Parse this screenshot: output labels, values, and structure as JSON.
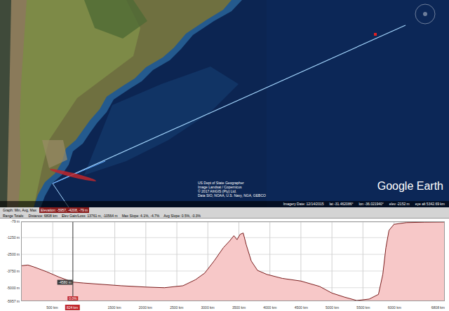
{
  "map": {
    "attribution": [
      "US Dept of State Geographer",
      "Image Landsat / Copernicus",
      "© 2017 AfriGIS (Pty) Ltd.",
      "Data SIO, NOAA, U.S. Navy, NGA, GEBCO"
    ],
    "logo": "Google Earth",
    "status": [
      "Imagery Date: 12/14/2015",
      "lat -31.462086°",
      "lon -36.021940°",
      "elev -2152 m",
      "eye alt 5342.69 km"
    ]
  },
  "graph": {
    "summary_label": "Graph: Min, Avg, Max",
    "summary_value": "Elevation: -5957, -4208, -79 m",
    "totals": [
      "Range Totals:",
      "Distance: 6808 km",
      "Elev Gain/Loss: 13761 m, -10564 m",
      "Max Slope: 4.1%, -4.7%",
      "Avg Slope: 0.5%, -0.3%"
    ],
    "y_ticks": [
      {
        "label": "-79 m",
        "value": -79
      },
      {
        "label": "-1250 m",
        "value": -1250
      },
      {
        "label": "-2500 m",
        "value": -2500
      },
      {
        "label": "-3750 m",
        "value": -3750
      },
      {
        "label": "-5000 m",
        "value": -5000
      },
      {
        "label": "-5957 m",
        "value": -5957
      }
    ],
    "x_ticks": [
      {
        "label": "500 km",
        "value": 500
      },
      {
        "label": "1500 km",
        "value": 1500
      },
      {
        "label": "2000 km",
        "value": 2000
      },
      {
        "label": "2500 km",
        "value": 2500
      },
      {
        "label": "3000 km",
        "value": 3000
      },
      {
        "label": "3500 km",
        "value": 3500
      },
      {
        "label": "4000 km",
        "value": 4000
      },
      {
        "label": "4500 km",
        "value": 4500
      },
      {
        "label": "5000 km",
        "value": 5000
      },
      {
        "label": "5500 km",
        "value": 5500
      },
      {
        "label": "6000 km",
        "value": 6000
      },
      {
        "label": "6808 km",
        "value": 6808
      }
    ],
    "cursor": {
      "distance_km": 824,
      "distance_label": "824 km",
      "elevation_m": -4580,
      "elevation_label": "-4580 m",
      "slope": "0.0%"
    },
    "series": {
      "distance_km": [
        0,
        100,
        200,
        400,
        600,
        824,
        1000,
        1300,
        1600,
        2000,
        2300,
        2600,
        2800,
        2950,
        3100,
        3250,
        3350,
        3420,
        3470,
        3520,
        3570,
        3620,
        3700,
        3800,
        3950,
        4200,
        4500,
        4800,
        5000,
        5200,
        5400,
        5600,
        5750,
        5820,
        5870,
        5920,
        6000,
        6200,
        6500,
        6808
      ],
      "elevation_m": [
        -3350,
        -3300,
        -3450,
        -3800,
        -4200,
        -4580,
        -4650,
        -4750,
        -4850,
        -4950,
        -5000,
        -4850,
        -4400,
        -3900,
        -3000,
        -2000,
        -1500,
        -1100,
        -1400,
        -1000,
        -900,
        -1800,
        -3000,
        -3700,
        -4000,
        -4300,
        -4500,
        -4900,
        -5400,
        -5700,
        -5957,
        -5850,
        -5500,
        -4000,
        -2000,
        -700,
        -250,
        -120,
        -90,
        -79
      ]
    }
  }
}
